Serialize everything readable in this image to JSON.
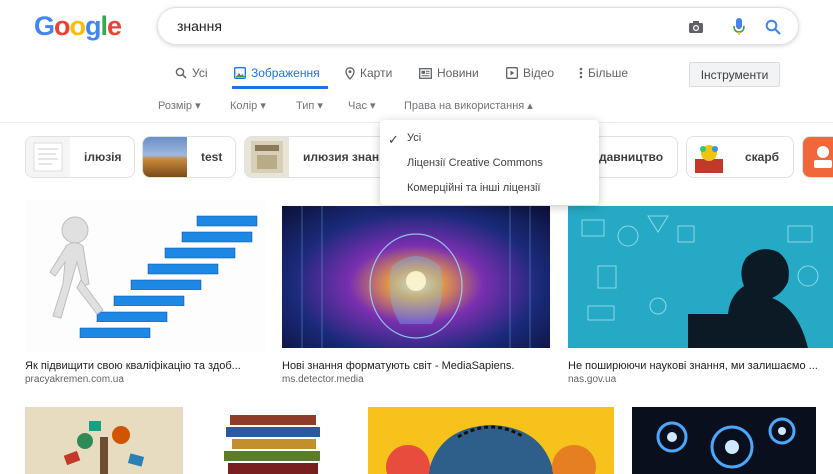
{
  "logo": {
    "letters": [
      "G",
      "o",
      "o",
      "g",
      "l",
      "e"
    ]
  },
  "search": {
    "query": "знання"
  },
  "tabs": {
    "all": "Усі",
    "images": "Зображення",
    "maps": "Карти",
    "news": "Новини",
    "video": "Відео",
    "more": "Більше",
    "tools": "Інструменти"
  },
  "filters": {
    "size": "Розмір",
    "color": "Колір",
    "type": "Тип",
    "time": "Час",
    "rights": "Права на використання"
  },
  "chips": [
    {
      "label": "ілюзія"
    },
    {
      "label": "test"
    },
    {
      "label": "илюзия знан"
    },
    {
      "label": "давництво"
    },
    {
      "label": "скарб"
    }
  ],
  "dropdown": {
    "items": [
      "Усі",
      "Ліцензії Creative Commons",
      "Комерційні та інші ліцензії"
    ],
    "selected": "Усі"
  },
  "results": [
    {
      "title": "Як підвищити свою кваліфікацію та здоб...",
      "site": "pracyakremen.com.ua"
    },
    {
      "title": "Нові знання форматують світ - MediaSapiens.",
      "site": "ms.detector.media"
    },
    {
      "title": "Не поширюючи наукові знання, ми залишаємо ...",
      "site": "nas.gov.ua"
    }
  ],
  "colors": {
    "accent": "#1a73e8",
    "logo_blue": "#4285f4",
    "logo_red": "#ea4335",
    "logo_yellow": "#fbbc05",
    "logo_green": "#34a853"
  }
}
